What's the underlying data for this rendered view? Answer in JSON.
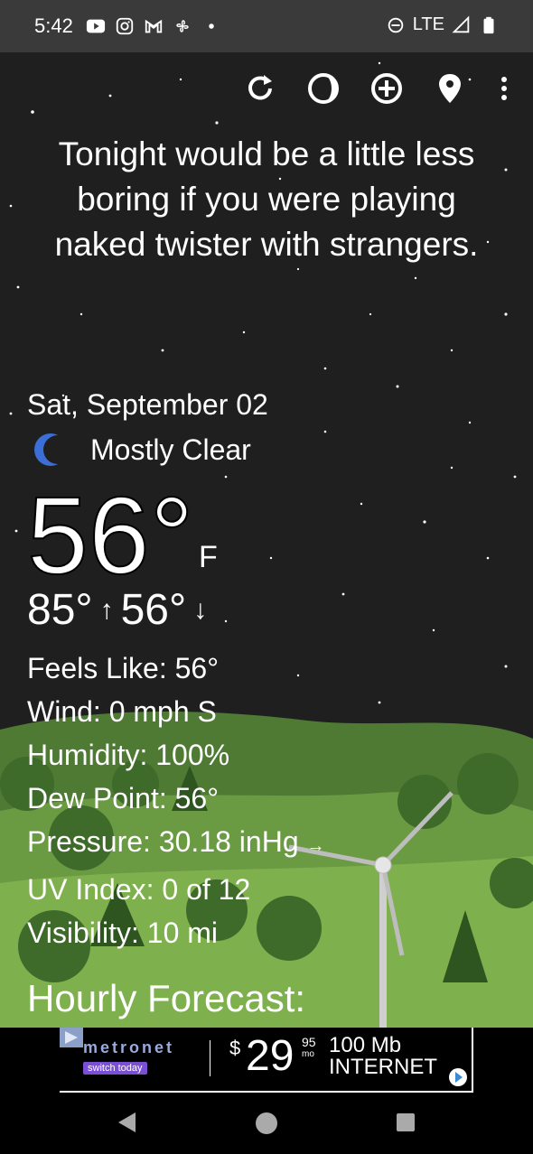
{
  "status_bar": {
    "time": "5:42",
    "network": "LTE"
  },
  "toolbar": {
    "icons": [
      "refresh-icon",
      "moon-phase-icon",
      "add-location-icon",
      "location-pin-icon",
      "more-vert-icon"
    ]
  },
  "headline": "Tonight would be a little less boring if you were playing naked twister with strangers.",
  "weather": {
    "date": "Sat, September 02",
    "condition": "Mostly Clear",
    "temperature": "56°",
    "unit": "F",
    "high": "85°",
    "high_arrow": "↑",
    "low": "56°",
    "low_arrow": "↓",
    "details": {
      "feels_like": "Feels Like:  56°",
      "wind": "Wind:  0 mph S",
      "humidity": "Humidity:  100%",
      "dew_point": "Dew Point:  56°",
      "pressure": "Pressure:  30.18 inHg",
      "pressure_trend": "→",
      "uv_index": "UV Index:  0 of 12",
      "visibility": "Visibility:  10 mi"
    },
    "hourly_title": "Hourly Forecast:"
  },
  "ad": {
    "brand": "metronet",
    "cta": "switch today",
    "price_dollar": "$",
    "price": "29",
    "price_cents": "95",
    "price_period": "mo",
    "speed_line1": "100 Mb",
    "speed_line2": "INTERNET"
  },
  "colors": {
    "sky": "#1f1f1f",
    "hill": "#5a8a3c",
    "accent_moon": "#3b6fd6"
  }
}
